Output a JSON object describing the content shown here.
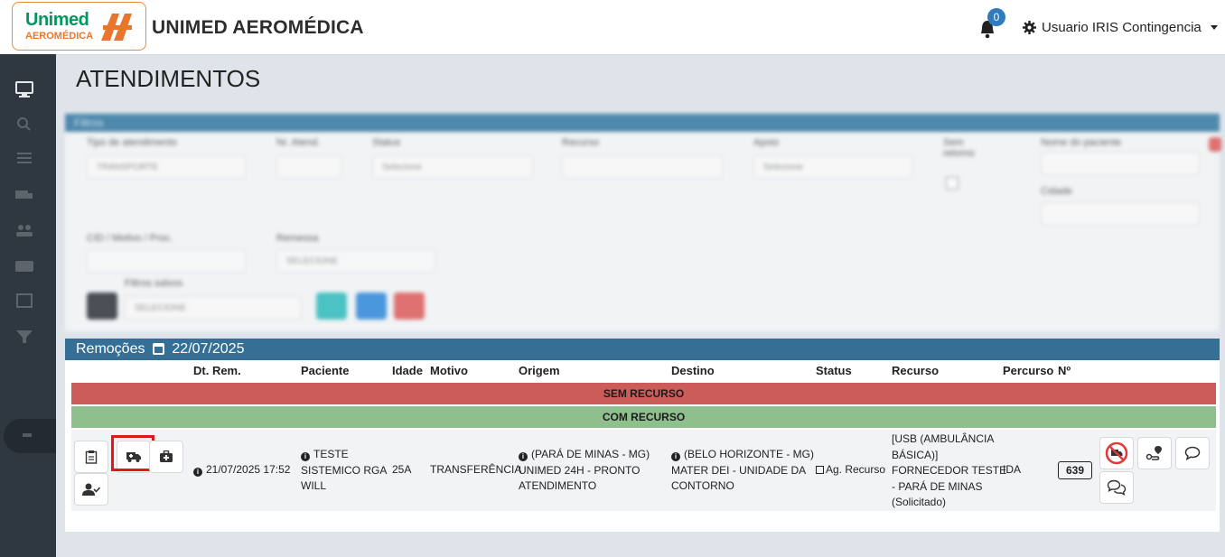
{
  "header": {
    "logo_line1": "Unimed",
    "logo_line2": "AEROMÉDICA",
    "app_title": "UNIMED AEROMÉDICA",
    "notification_count": "0",
    "user_name": "Usuario IRIS Contingencia"
  },
  "page": {
    "title": "ATENDIMENTOS"
  },
  "filters": {
    "title": "Filtros",
    "fields": [
      {
        "label": "Tipo de atendimento",
        "value": "TRANSPORTE"
      },
      {
        "label": "Nr. Atend.",
        "value": ""
      },
      {
        "label": "Status",
        "value": "Selecione"
      },
      {
        "label": "Recurso",
        "value": ""
      },
      {
        "label": "Apoio",
        "value": "Selecione"
      },
      {
        "label": "Sem retorno",
        "value": ""
      },
      {
        "label": "Nome do paciente",
        "value": ""
      },
      {
        "label": "Cidade",
        "value": ""
      },
      {
        "label": "CID / Motivo / Proc.",
        "value": ""
      },
      {
        "label": "Remessa",
        "value": "SELECIONE"
      },
      {
        "label": "Filtros salvos",
        "value": "SELECIONE"
      }
    ]
  },
  "panel": {
    "title": "Remoções",
    "date": "22/07/2025",
    "columns": {
      "dt_rem": "Dt. Rem.",
      "paciente": "Paciente",
      "idade": "Idade",
      "motivo": "Motivo",
      "origem": "Origem",
      "destino": "Destino",
      "status": "Status",
      "recurso": "Recurso",
      "percurso": "Percurso",
      "numero": "Nº"
    },
    "band_sem_recurso": "SEM RECURSO",
    "band_com_recurso": "COM RECURSO",
    "row": {
      "dt_rem": "21/07/2025 17:52",
      "paciente_line1": "TESTE",
      "paciente_line2": "SISTEMICO RGA",
      "paciente_line3": "WILL",
      "idade": "25A",
      "motivo": "TRANSFERÊNCIA",
      "origem_line1": "(PARÁ DE MINAS - MG)",
      "origem_line2": "UNIMED 24H - PRONTO",
      "origem_line3": "ATENDIMENTO",
      "destino_line1": "(BELO HORIZONTE - MG)",
      "destino_line2": "MATER DEI - UNIDADE DA",
      "destino_line3": "CONTORNO",
      "status": "Ag. Recurso",
      "recurso_line1": "[USB (AMBULÂNCIA",
      "recurso_line2": "BÁSICA)]",
      "recurso_line3": "FORNECEDOR TESTE",
      "recurso_line4": "- PARÁ DE MINAS",
      "recurso_line5": "(Solicitado)",
      "percurso": "IDA",
      "numero": "639"
    }
  },
  "icons": {
    "sidebar": [
      "monitor-icon",
      "search-icon",
      "list-icon",
      "ambulance-icon",
      "users-icon",
      "card-icon",
      "map-icon",
      "filter-icon",
      "logout-icon"
    ],
    "accent_blue": "#356f96",
    "band_red": "#cc5c5a",
    "band_green": "#8fbf8c"
  }
}
